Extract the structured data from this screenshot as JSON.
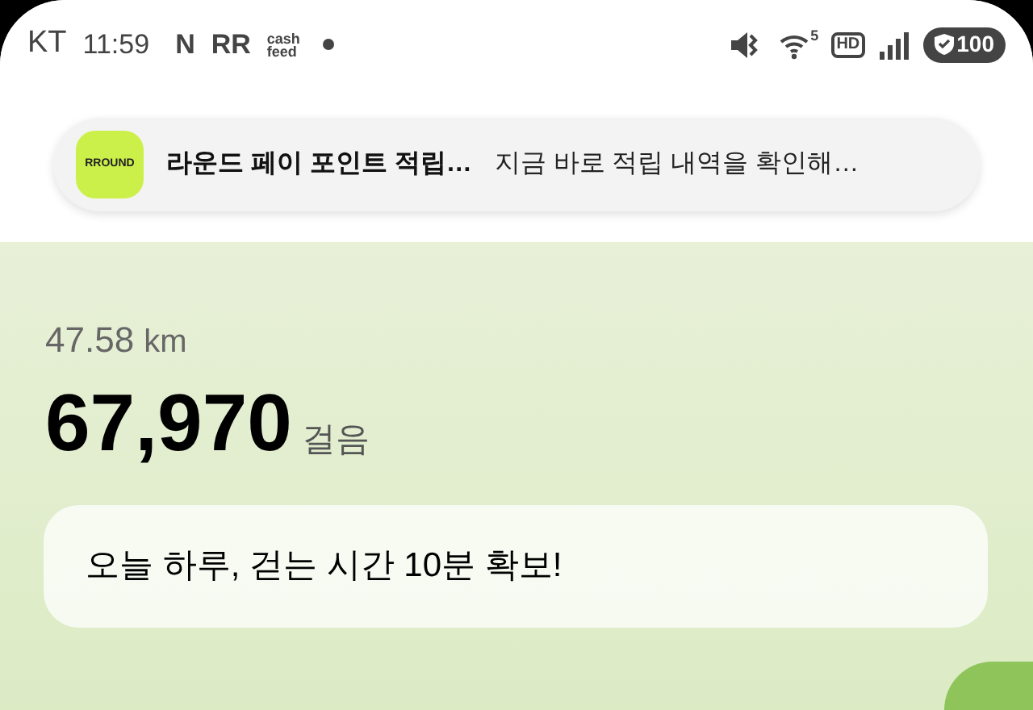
{
  "status_bar": {
    "carrier": "KT",
    "time": "11:59",
    "app_icons": [
      "N",
      "RR"
    ],
    "cashfeed": [
      "cash",
      "feed"
    ],
    "wifi_badge": "5",
    "hd": "HD",
    "battery": "100"
  },
  "notification": {
    "app_logo": "RROUND",
    "title": "라운드 페이 포인트 적립…",
    "body": "지금 바로 적립 내역을 확인해…"
  },
  "stats": {
    "distance": "47.58",
    "distance_unit": "km",
    "steps": "67,970",
    "steps_unit": "걸음"
  },
  "banner": {
    "text": "오늘 하루, 걷는 시간 10분 확보!"
  }
}
